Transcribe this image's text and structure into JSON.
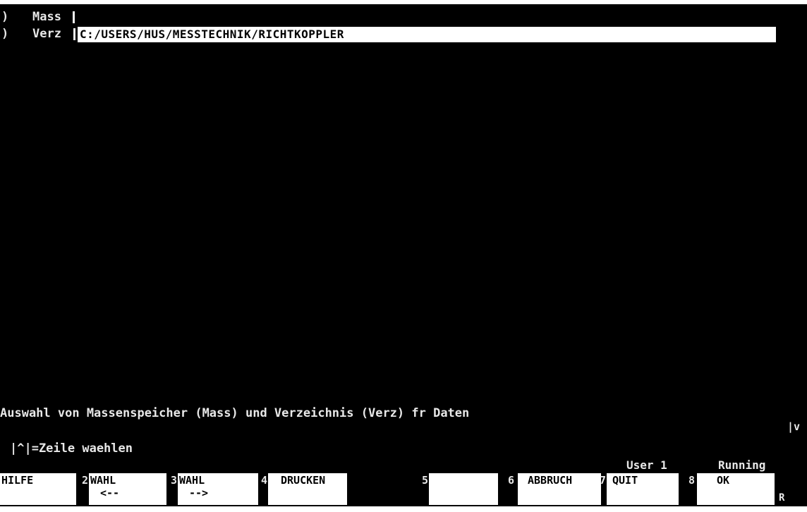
{
  "fields": {
    "mass": {
      "marker": ")",
      "label": "Mass"
    },
    "verz": {
      "marker": ")",
      "label": "Verz",
      "value": "C:/USERS/HUS/MESSTECHNIK/RICHTKOPPLER"
    }
  },
  "status": {
    "description": "Auswahl von Massenspeicher (Mass) und Verzeichnis (Verz) fr Daten",
    "scroll_indicator": "|v",
    "hint": "|^|=Zeile waehlen",
    "user": "User 1",
    "state": "Running",
    "corner": "R"
  },
  "softkeys": [
    {
      "num": "",
      "line1": "HILFE",
      "line2": ""
    },
    {
      "num": "2",
      "line1": "WAHL",
      "line2": "<--"
    },
    {
      "num": "3",
      "line1": "WAHL",
      "line2": "-->"
    },
    {
      "num": "4",
      "line1": "DRUCKEN",
      "line2": ""
    },
    {
      "num": "5",
      "line1": "",
      "line2": ""
    },
    {
      "num": "6",
      "line1": "ABBRUCH",
      "line2": ""
    },
    {
      "num": "7",
      "line1": "QUIT",
      "line2": ""
    },
    {
      "num": "8",
      "line1": "OK",
      "line2": ""
    }
  ],
  "colors": {
    "screen_bg": "#000000",
    "text": "#e8e8e8",
    "softkey_bg": "#ffffff",
    "softkey_text": "#000000"
  }
}
